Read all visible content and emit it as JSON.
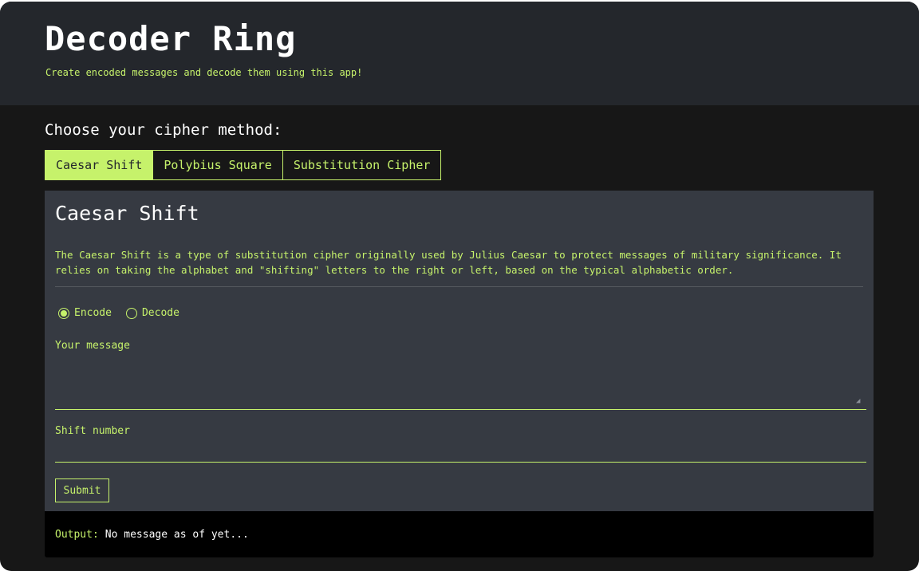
{
  "header": {
    "title": "Decoder Ring",
    "subtitle": "Create encoded messages and decode them using this app!"
  },
  "chooser": {
    "label": "Choose your cipher method:",
    "tabs": [
      {
        "label": "Caesar Shift",
        "active": true
      },
      {
        "label": "Polybius Square",
        "active": false
      },
      {
        "label": "Substitution Cipher",
        "active": false
      }
    ]
  },
  "panel": {
    "title": "Caesar Shift",
    "description": "The Caesar Shift is a type of substitution cipher originally used by Julius Caesar to protect messages of military significance. It relies on taking the alphabet and \"shifting\" letters to the right or left, based on the typical alphabetic order.",
    "modes": [
      {
        "label": "Encode",
        "selected": true
      },
      {
        "label": "Decode",
        "selected": false
      }
    ],
    "message_label": "Your message",
    "message_value": "",
    "shift_label": "Shift number",
    "shift_value": "",
    "submit_label": "Submit"
  },
  "output": {
    "label": "Output:",
    "text": "No message as of yet..."
  },
  "colors": {
    "accent": "#c6f26b",
    "header_bg": "#24272c",
    "panel_bg": "#363a42",
    "page_bg": "#171717",
    "output_bg": "#000000"
  }
}
